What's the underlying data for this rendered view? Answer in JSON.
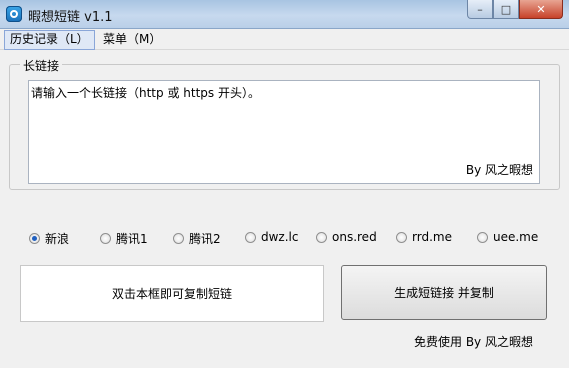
{
  "window": {
    "title": "暇想短链 v1.1"
  },
  "menubar": {
    "items": [
      {
        "label": "历史记录（L）"
      },
      {
        "label": "菜单（M）"
      }
    ]
  },
  "long_link": {
    "group_label": "长链接",
    "placeholder": "请输入一个长链接（http 或 https 开头）。",
    "signature": "By 风之暇想"
  },
  "services": [
    {
      "label": "新浪",
      "checked": true
    },
    {
      "label": "腾讯1",
      "checked": false
    },
    {
      "label": "腾讯2",
      "checked": false
    },
    {
      "label": "dwz.lc",
      "checked": false
    },
    {
      "label": "ons.red",
      "checked": false
    },
    {
      "label": "rrd.me",
      "checked": false
    },
    {
      "label": "uee.me",
      "checked": false
    }
  ],
  "output": {
    "hint": "双击本框即可复制短链"
  },
  "actions": {
    "generate_label": "生成短链接 并复制"
  },
  "footer": {
    "text": "免费使用 By 风之暇想"
  },
  "colors": {
    "accent": "#1f5fbf",
    "titlebar": "#b9cfe8",
    "close": "#c7422a"
  }
}
